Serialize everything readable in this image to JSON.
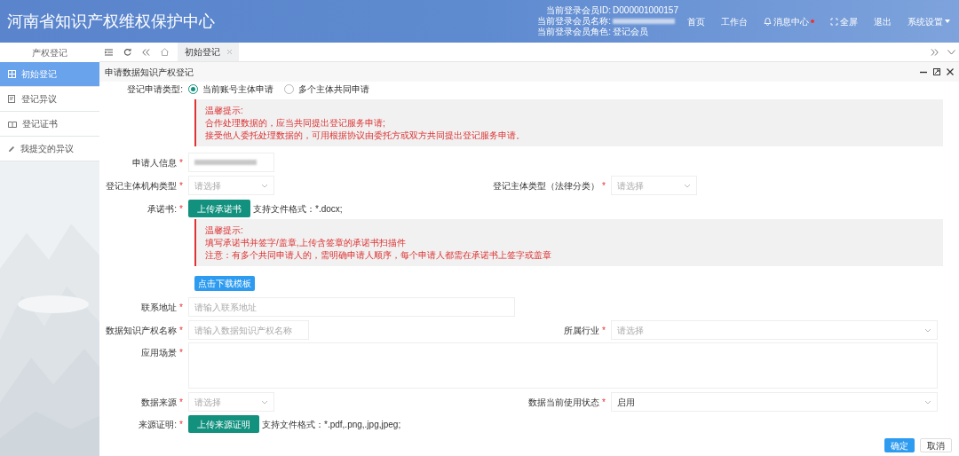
{
  "header": {
    "title": "河南省知识产权维权保护中心",
    "user_info": [
      {
        "label": "当前登录会员ID:",
        "value": "D000001000157",
        "redacted": false
      },
      {
        "label": "当前登录会员名称:",
        "redacted": true
      },
      {
        "label": "当前登录会员角色:",
        "value": "登记会员",
        "redacted": false
      }
    ],
    "nav": [
      {
        "kind": "plain",
        "label": "首页"
      },
      {
        "kind": "plain",
        "label": "工作台"
      },
      {
        "kind": "notify",
        "label": "消息中心",
        "alert": true
      },
      {
        "kind": "fullscreen",
        "label": "全屏"
      },
      {
        "kind": "plain",
        "label": "退出"
      },
      {
        "kind": "menu",
        "label": "系统设置"
      }
    ]
  },
  "sidebar": {
    "title": "产权登记",
    "items": [
      {
        "kind": "grid",
        "label": "初始登记",
        "selected": true
      },
      {
        "kind": "doc",
        "label": "登记异议",
        "selected": false
      },
      {
        "kind": "book",
        "label": "登记证书",
        "selected": false
      },
      {
        "kind": "pen",
        "label": "我提交的异议",
        "selected": false
      }
    ]
  },
  "tabs": [
    {
      "label": "初始登记",
      "selected": true
    }
  ],
  "panel": {
    "title": "申请数据知识产权登记",
    "registration_type": {
      "label": "登记申请类型:",
      "options": [
        {
          "label": "当前账号主体申请",
          "selected": true
        },
        {
          "label": "多个主体共同申请",
          "selected": false
        }
      ]
    },
    "notice_1": {
      "title": "温馨提示:",
      "lines": [
        "合作处理数据的，应当共同提出登记服务申请;",
        "接受他人委托处理数据的，可用根据协议由委托方或双方共同提出登记服务申请。"
      ]
    },
    "applicant": {
      "label": "申请人信息",
      "required_mark": "*",
      "redacted": true
    },
    "org_type": {
      "label": "登记主体机构类型",
      "required_mark": "*",
      "placeholder": "请选择"
    },
    "legal_type": {
      "label": "登记主体类型（法律分类）",
      "required_mark": "*",
      "placeholder": "请选择"
    },
    "commitment": {
      "label": "承诺书:",
      "required_mark": "*",
      "button": "上传承诺书",
      "hint": "支持文件格式：*.docx;"
    },
    "notice_2": {
      "title": "温馨提示:",
      "lines": [
        "填写承诺书并签字/盖章,上传含签章的承诺书扫描件",
        "注意：有多个共同申请人的，需明确申请人顺序，每个申请人都需在承诺书上签字或盖章"
      ]
    },
    "download_button": "点击下载模板",
    "address": {
      "label": "联系地址",
      "required_mark": "*",
      "placeholder": "请输入联系地址"
    },
    "ip_name": {
      "label": "数据知识产权名称",
      "required_mark": "*",
      "placeholder": "请输入数据知识产权名称"
    },
    "industry": {
      "label": "所属行业",
      "required_mark": "*",
      "placeholder": "请选择"
    },
    "scenario": {
      "label": "应用场景",
      "required_mark": "*"
    },
    "data_source": {
      "label": "数据来源",
      "required_mark": "*",
      "placeholder": "请选择"
    },
    "usage_status": {
      "label": "数据当前使用状态",
      "required_mark": "*",
      "value": "启用"
    },
    "source_proof": {
      "label": "来源证明:",
      "required_mark": "*",
      "button": "上传来源证明",
      "hint": "支持文件格式：*.pdf,.png,.jpg,jpeg;"
    },
    "actions": [
      {
        "kind": "primary",
        "label": "确定"
      },
      {
        "kind": "secondary",
        "label": "取消"
      }
    ]
  }
}
